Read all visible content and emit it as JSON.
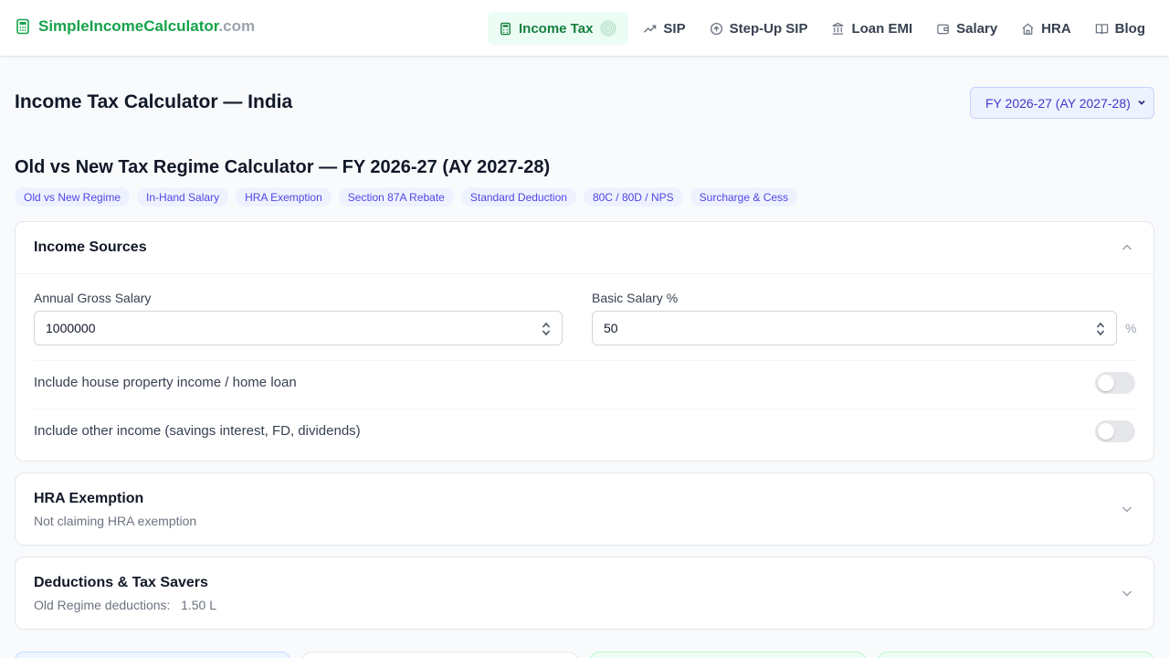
{
  "brand": {
    "name": "SimpleIncomeCalculator",
    "tld": ".com"
  },
  "nav": [
    {
      "label": "Income Tax",
      "icon": "calculator-icon",
      "active": true
    },
    {
      "label": "SIP",
      "icon": "trending-up-icon"
    },
    {
      "label": "Step-Up SIP",
      "icon": "arrow-up-circle-icon"
    },
    {
      "label": "Loan EMI",
      "icon": "bank-icon"
    },
    {
      "label": "Salary",
      "icon": "wallet-icon"
    },
    {
      "label": "HRA",
      "icon": "home-icon"
    },
    {
      "label": "Blog",
      "icon": "book-icon"
    }
  ],
  "page": {
    "title": "Income Tax Calculator — India",
    "fy_selected": "FY 2026-27 (AY 2027-28)",
    "subtitle": "Old vs New Tax Regime Calculator — FY 2026-27 (AY 2027-28)",
    "tags": [
      "Old vs New Regime",
      "In-Hand Salary",
      "HRA Exemption",
      "Section 87A Rebate",
      "Standard Deduction",
      "80C / 80D / NPS",
      "Surcharge & Cess"
    ]
  },
  "income": {
    "title": "Income Sources",
    "gross_label": "Annual Gross Salary",
    "gross_value": "1000000",
    "basic_label": "Basic Salary %",
    "basic_value": "50",
    "basic_unit": "%",
    "toggle_house": "Include house property income / home loan",
    "toggle_other": "Include other income (savings interest, FD, dividends)"
  },
  "hra": {
    "title": "HRA Exemption",
    "subtitle": "Not claiming HRA exemption"
  },
  "deductions": {
    "title": "Deductions & Tax Savers",
    "subtitle": "Old Regime deductions:   1.50 L"
  },
  "colors": {
    "brand_green": "#16a34a",
    "accent_indigo": "#4f46e5"
  }
}
